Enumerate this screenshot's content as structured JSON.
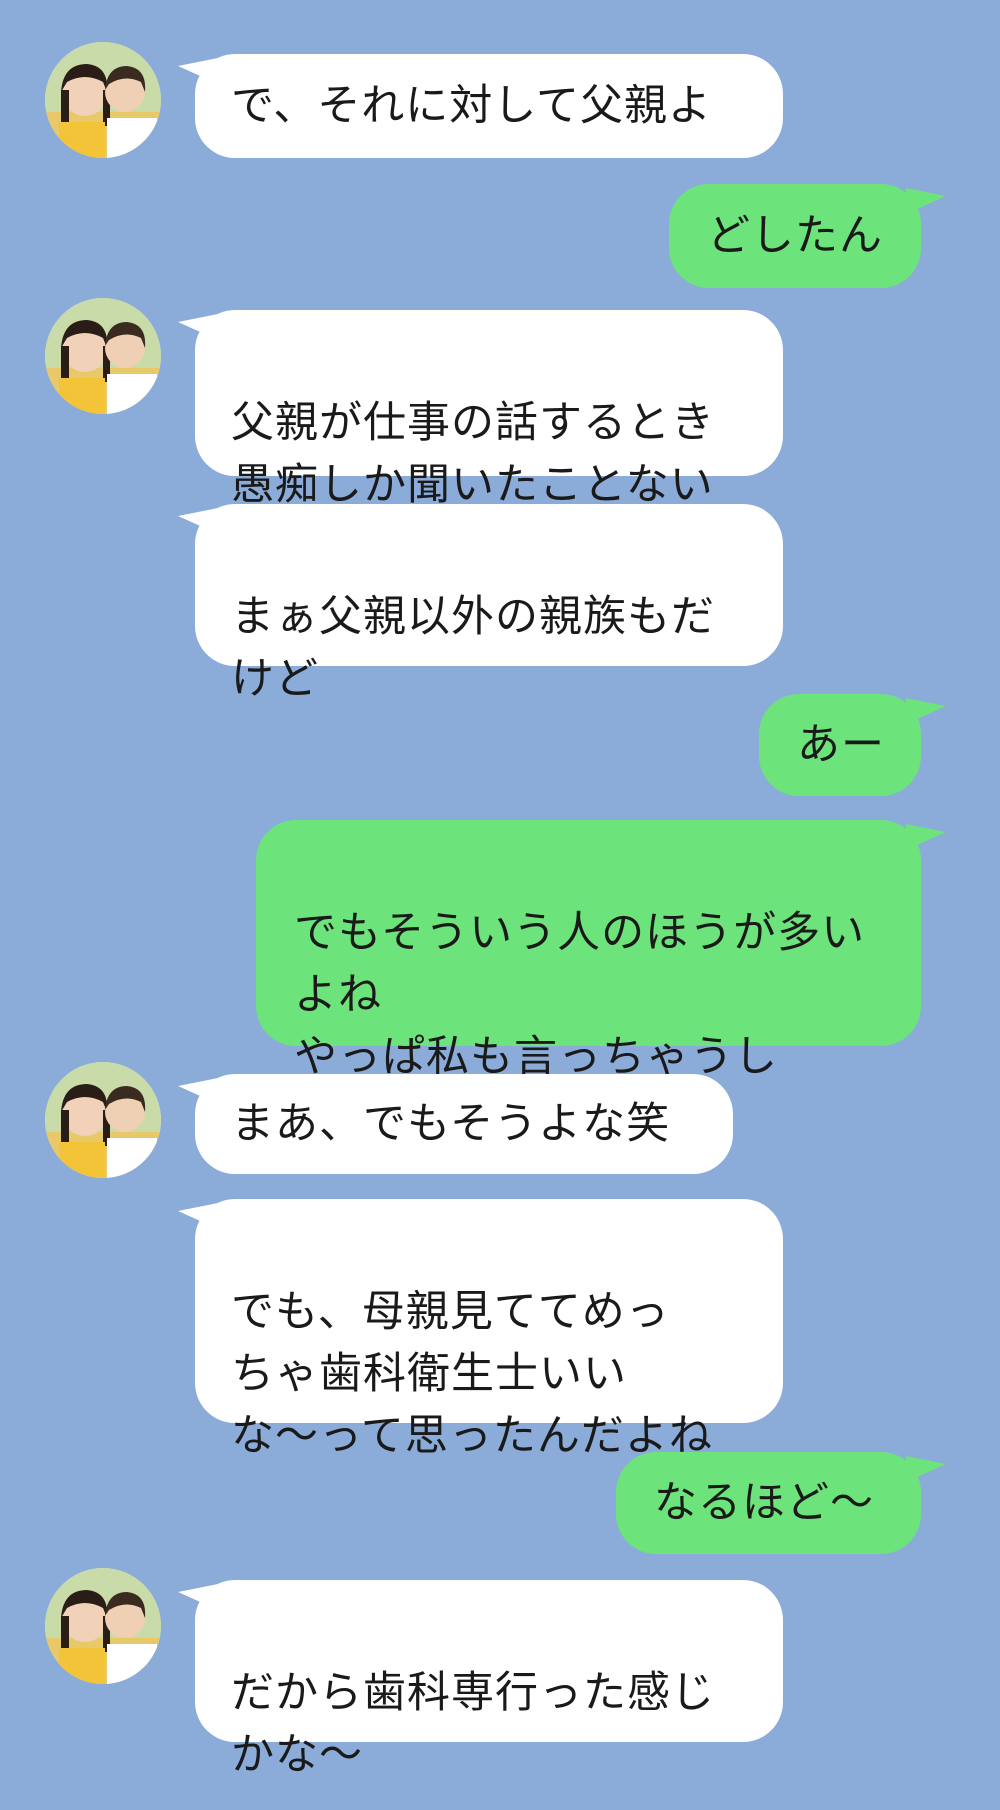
{
  "chat": {
    "background_color": "#8BABD8",
    "incoming_bubble_color": "#ffffff",
    "outgoing_bubble_color": "#6DE47B",
    "messages": [
      {
        "from": "other",
        "text": "で、それに対して父親よ"
      },
      {
        "from": "me",
        "text": "どしたん"
      },
      {
        "from": "other",
        "text": "父親が仕事の話するとき\n愚痴しか聞いたことない"
      },
      {
        "from": "other",
        "text": "まぁ父親以外の親族もだ\nけど"
      },
      {
        "from": "me",
        "text": "あー"
      },
      {
        "from": "me",
        "text": "でもそういう人のほうが多い\nよね\nやっぱ私も言っちゃうし"
      },
      {
        "from": "other",
        "text": "まあ、でもそうよな笑"
      },
      {
        "from": "other",
        "text": "でも、母親見ててめっ\nちゃ歯科衛生士いい\nな〜って思ったんだよね"
      },
      {
        "from": "me",
        "text": "なるほど〜"
      },
      {
        "from": "other",
        "text": "だから歯科専行った感じ\nかな〜"
      }
    ]
  },
  "avatar": {
    "icon": "two-people-photo-icon"
  }
}
